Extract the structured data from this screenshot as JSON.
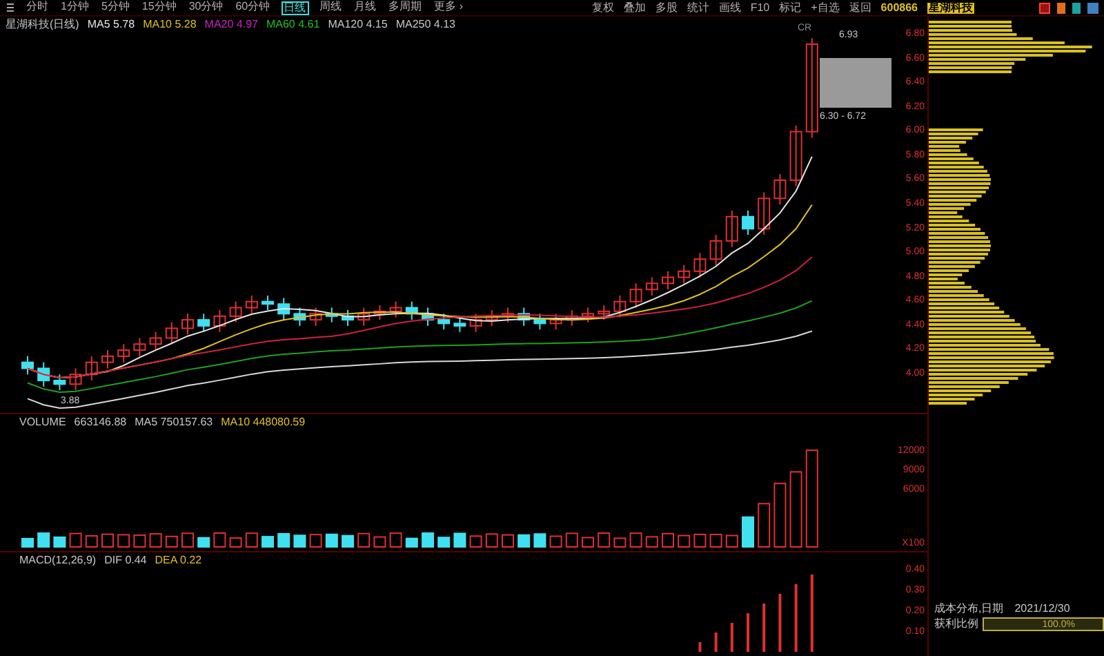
{
  "toolbar": {
    "periods": [
      {
        "label": "分时",
        "selected": false
      },
      {
        "label": "1分钟",
        "selected": false
      },
      {
        "label": "5分钟",
        "selected": false
      },
      {
        "label": "15分钟",
        "selected": false
      },
      {
        "label": "30分钟",
        "selected": false
      },
      {
        "label": "60分钟",
        "selected": false
      },
      {
        "label": "日线",
        "selected": true
      },
      {
        "label": "周线",
        "selected": false
      },
      {
        "label": "月线",
        "selected": false
      },
      {
        "label": "多周期",
        "selected": false
      },
      {
        "label": "更多 ›",
        "selected": false
      }
    ],
    "actions": [
      "复权",
      "叠加",
      "多股",
      "统计",
      "画线",
      "F10",
      "标记",
      "+自选",
      "返回"
    ],
    "stock_code": "600866",
    "stock_name": "星湖科技"
  },
  "price_legend": {
    "title": "星湖科技(日线)",
    "items": [
      {
        "label": "MA5",
        "value": "5.78",
        "color": "#e5e5e5"
      },
      {
        "label": "MA10",
        "value": "5.28",
        "color": "#e0c020"
      },
      {
        "label": "MA20",
        "value": "4.97",
        "color": "#d020c0"
      },
      {
        "label": "MA60",
        "value": "4.61",
        "color": "#20c020"
      },
      {
        "label": "MA120",
        "value": "4.15",
        "color": "#c8c8c8"
      },
      {
        "label": "MA250",
        "value": "4.13",
        "color": "#c8c8c8"
      }
    ]
  },
  "cost_header": "CR",
  "price_axis": [
    "6.80",
    "6.60",
    "6.40",
    "6.20",
    "6.00",
    "5.80",
    "5.60",
    "5.40",
    "5.20",
    "5.00",
    "4.80",
    "4.60",
    "4.40",
    "4.20",
    "4.00"
  ],
  "price_annotations": {
    "high": "6.93",
    "range": "6.30 - 6.72",
    "low": "3.88"
  },
  "volume_legend": {
    "title": "VOLUME",
    "items": [
      {
        "value": "663146.88",
        "color": "#c8c8c8"
      },
      {
        "label": "MA5",
        "value": "750157.63",
        "color": "#c8c8c8"
      },
      {
        "label": "MA10",
        "value": "448080.59",
        "color": "#e0c020"
      }
    ]
  },
  "volume_axis": [
    "12000",
    "9000",
    "6000"
  ],
  "volume_unit": "X100",
  "macd_legend": {
    "title": "MACD(12,26,9)",
    "items": [
      {
        "label": "DIF",
        "value": "0.44",
        "color": "#c8c8c8"
      },
      {
        "label": "DEA",
        "value": "0.22",
        "color": "#e0c020"
      }
    ]
  },
  "macd_axis": [
    "0.40",
    "0.30",
    "0.20",
    "0.10"
  ],
  "cost_distribution": {
    "title": "成本分布,日期",
    "date": "2021/12/30",
    "profit_label": "获利比例",
    "level": 1,
    "reading": "100.0%"
  }
}
